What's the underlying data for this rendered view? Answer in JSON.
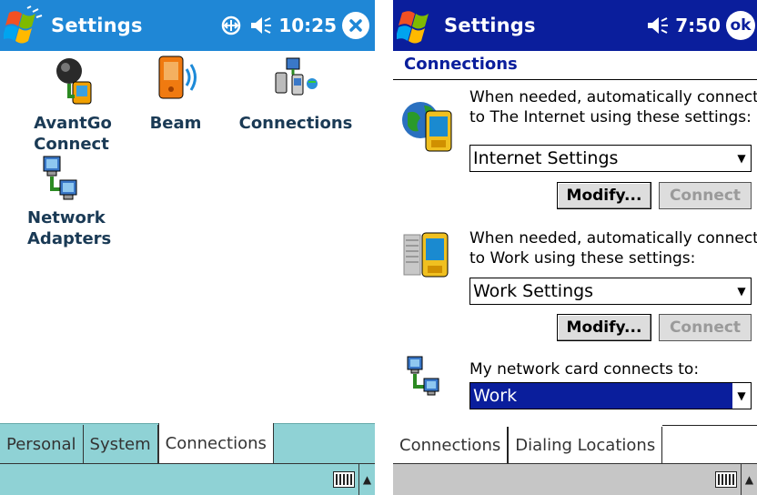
{
  "left": {
    "title": "Settings",
    "time": "10:25",
    "icons": [
      {
        "label_line1": "AvantGo",
        "label_line2": "Connect"
      },
      {
        "label_line1": "Beam",
        "label_line2": ""
      },
      {
        "label_line1": "Connections",
        "label_line2": ""
      },
      {
        "label_line1": "Network",
        "label_line2": "Adapters"
      }
    ],
    "tabs": [
      "Personal",
      "System",
      "Connections"
    ],
    "active_tab": "Connections",
    "icon_names": [
      "start-flag-icon",
      "connectivity-icon",
      "speaker-icon",
      "close-icon",
      "keyboard-icon"
    ]
  },
  "right": {
    "title": "Settings",
    "time": "7:50",
    "ok_label": "ok",
    "section_title": "Connections",
    "internet": {
      "desc_line1": "When needed, automatically connect",
      "desc_line2": "to The Internet using these settings:",
      "selected": "Internet Settings",
      "modify_label": "Modify...",
      "connect_label": "Connect"
    },
    "work": {
      "desc_line1": "When needed, automatically connect",
      "desc_line2": "to Work using these settings:",
      "selected": "Work Settings",
      "modify_label": "Modify...",
      "connect_label": "Connect"
    },
    "network": {
      "desc": "My network card connects to:",
      "selected": "Work"
    },
    "tabs": [
      "Connections",
      "Dialing Locations"
    ],
    "active_tab": "Connections"
  },
  "colors": {
    "left_titlebar": "#1f87d6",
    "right_titlebar": "#0a1e9c",
    "left_tab_bg": "#8fd2d5",
    "selection": "#0a1e9c"
  }
}
